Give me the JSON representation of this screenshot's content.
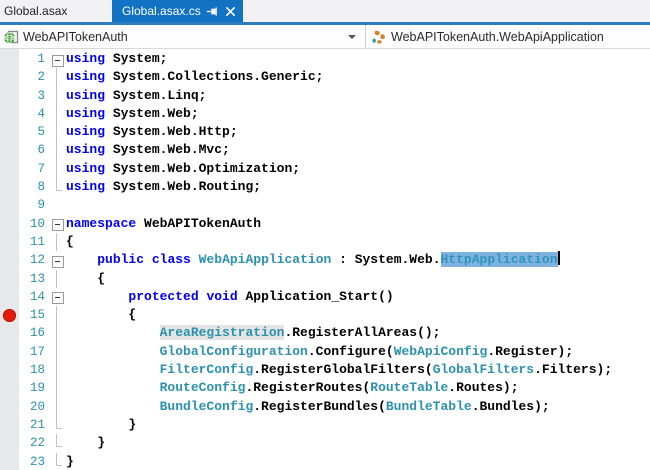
{
  "tabs": {
    "inactive_label": "Global.asax",
    "active_label": "Global.asax.cs",
    "pin_icon": "pin-icon",
    "close_icon": "close-icon"
  },
  "navbar": {
    "project_label": "WebAPITokenAuth",
    "project_icon": "project-icon",
    "dropdown_icon": "chevron-down-icon",
    "type_label": "WebAPITokenAuth.WebApiApplication",
    "type_icon": "class-icon"
  },
  "colors": {
    "active_tab_blue": "#1272C3",
    "accent_underline_blue": "#2F7CC1",
    "keyword_blue": "#0000F2",
    "type_teal": "#2B91AF",
    "line_number_teal": "#2B91AF",
    "selection_blue": "#7FB2DE",
    "reference_highlight_gray": "#E4E4E4",
    "breakpoint_red": "#E21B0C",
    "glyph_margin_gray": "#E7E8EA"
  },
  "editor": {
    "breakpoint_line": 15,
    "lines": [
      {
        "n": 1,
        "o": "box",
        "s": [
          [
            "k",
            "using"
          ],
          [
            "p",
            " System;"
          ]
        ]
      },
      {
        "n": 2,
        "o": "line",
        "s": [
          [
            "k",
            "using"
          ],
          [
            "p",
            " System.Collections.Generic;"
          ]
        ]
      },
      {
        "n": 3,
        "o": "line",
        "s": [
          [
            "k",
            "using"
          ],
          [
            "p",
            " System.Linq;"
          ]
        ]
      },
      {
        "n": 4,
        "o": "line",
        "s": [
          [
            "k",
            "using"
          ],
          [
            "p",
            " System.Web;"
          ]
        ]
      },
      {
        "n": 5,
        "o": "line",
        "s": [
          [
            "k",
            "using"
          ],
          [
            "p",
            " System.Web.Http;"
          ]
        ]
      },
      {
        "n": 6,
        "o": "line",
        "s": [
          [
            "k",
            "using"
          ],
          [
            "p",
            " System.Web.Mvc;"
          ]
        ]
      },
      {
        "n": 7,
        "o": "line",
        "s": [
          [
            "k",
            "using"
          ],
          [
            "p",
            " System.Web.Optimization;"
          ]
        ]
      },
      {
        "n": 8,
        "o": "end",
        "s": [
          [
            "k",
            "using"
          ],
          [
            "p",
            " System.Web.Routing;"
          ]
        ]
      },
      {
        "n": 9,
        "o": "none",
        "s": []
      },
      {
        "n": 10,
        "o": "box",
        "s": [
          [
            "k",
            "namespace"
          ],
          [
            "p",
            " WebAPITokenAuth"
          ]
        ]
      },
      {
        "n": 11,
        "o": "line",
        "s": [
          [
            "p",
            "{"
          ]
        ]
      },
      {
        "n": 12,
        "o": "box",
        "s": [
          [
            "p",
            "    "
          ],
          [
            "k",
            "public"
          ],
          [
            "p",
            " "
          ],
          [
            "k",
            "class"
          ],
          [
            "p",
            " "
          ],
          [
            "t",
            "WebApiApplication"
          ],
          [
            "p",
            " : System.Web."
          ],
          [
            "s",
            "HttpApplication"
          ],
          [
            "c",
            ""
          ]
        ]
      },
      {
        "n": 13,
        "o": "line",
        "s": [
          [
            "p",
            "    {"
          ]
        ]
      },
      {
        "n": 14,
        "o": "box",
        "s": [
          [
            "p",
            "        "
          ],
          [
            "k",
            "protected"
          ],
          [
            "p",
            " "
          ],
          [
            "k",
            "void"
          ],
          [
            "p",
            " Application_Start()"
          ]
        ]
      },
      {
        "n": 15,
        "o": "line",
        "s": [
          [
            "p",
            "        {"
          ]
        ]
      },
      {
        "n": 16,
        "o": "line",
        "s": [
          [
            "p",
            "            "
          ],
          [
            "h",
            "AreaRegistration"
          ],
          [
            "p",
            ".RegisterAllAreas();"
          ]
        ]
      },
      {
        "n": 17,
        "o": "line",
        "s": [
          [
            "p",
            "            "
          ],
          [
            "t",
            "GlobalConfiguration"
          ],
          [
            "p",
            ".Configure("
          ],
          [
            "t",
            "WebApiConfig"
          ],
          [
            "p",
            ".Register);"
          ]
        ]
      },
      {
        "n": 18,
        "o": "line",
        "s": [
          [
            "p",
            "            "
          ],
          [
            "t",
            "FilterConfig"
          ],
          [
            "p",
            ".RegisterGlobalFilters("
          ],
          [
            "t",
            "GlobalFilters"
          ],
          [
            "p",
            ".Filters);"
          ]
        ]
      },
      {
        "n": 19,
        "o": "line",
        "s": [
          [
            "p",
            "            "
          ],
          [
            "t",
            "RouteConfig"
          ],
          [
            "p",
            ".RegisterRoutes("
          ],
          [
            "t",
            "RouteTable"
          ],
          [
            "p",
            ".Routes);"
          ]
        ]
      },
      {
        "n": 20,
        "o": "line",
        "s": [
          [
            "p",
            "            "
          ],
          [
            "t",
            "BundleConfig"
          ],
          [
            "p",
            ".RegisterBundles("
          ],
          [
            "t",
            "BundleTable"
          ],
          [
            "p",
            ".Bundles);"
          ]
        ]
      },
      {
        "n": 21,
        "o": "end",
        "s": [
          [
            "p",
            "        }"
          ]
        ]
      },
      {
        "n": 22,
        "o": "end",
        "s": [
          [
            "p",
            "    }"
          ]
        ]
      },
      {
        "n": 23,
        "o": "end",
        "s": [
          [
            "p",
            "}"
          ]
        ]
      }
    ]
  }
}
